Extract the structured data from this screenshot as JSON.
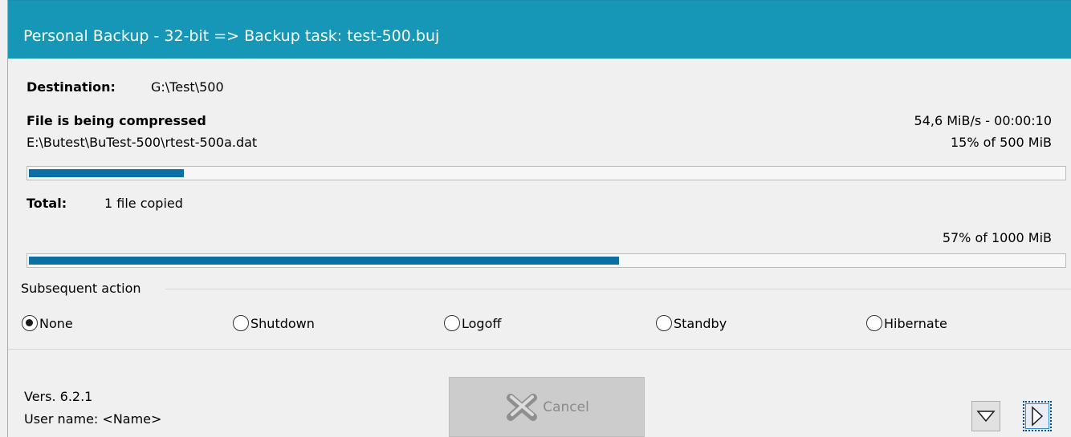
{
  "window": {
    "title": "Personal Backup - 32-bit => Backup task: test-500.buj"
  },
  "destination": {
    "label": "Destination:",
    "value": "G:\\Test\\500"
  },
  "current_file": {
    "status": "File is being compressed",
    "path": "E:\\Butest\\BuTest-500\\rtest-500a.dat",
    "speed_time": "54,6 MiB/s - 00:00:10",
    "progress_text": "15% of 500 MiB",
    "progress": 0.15
  },
  "total": {
    "label": "Total:",
    "value": "1 file copied",
    "progress_text": "57% of 1000 MiB",
    "progress": 0.57
  },
  "subsequent_action": {
    "heading": "Subsequent action",
    "options": [
      {
        "label": "None",
        "checked": true
      },
      {
        "label": "Shutdown",
        "checked": false
      },
      {
        "label": "Logoff",
        "checked": false
      },
      {
        "label": "Standby",
        "checked": false
      },
      {
        "label": "Hibernate",
        "checked": false
      }
    ]
  },
  "footer": {
    "version": "Vers. 6.2.1",
    "user": "User name: <Name>",
    "cancel_label": "Cancel"
  },
  "colors": {
    "title_bar": "#1697b7",
    "progress_fill": "#0a6fa5"
  },
  "icons": {
    "cancel": "cancel-x-icon",
    "dropdown": "triangle-down-icon",
    "next": "triangle-right-icon"
  }
}
